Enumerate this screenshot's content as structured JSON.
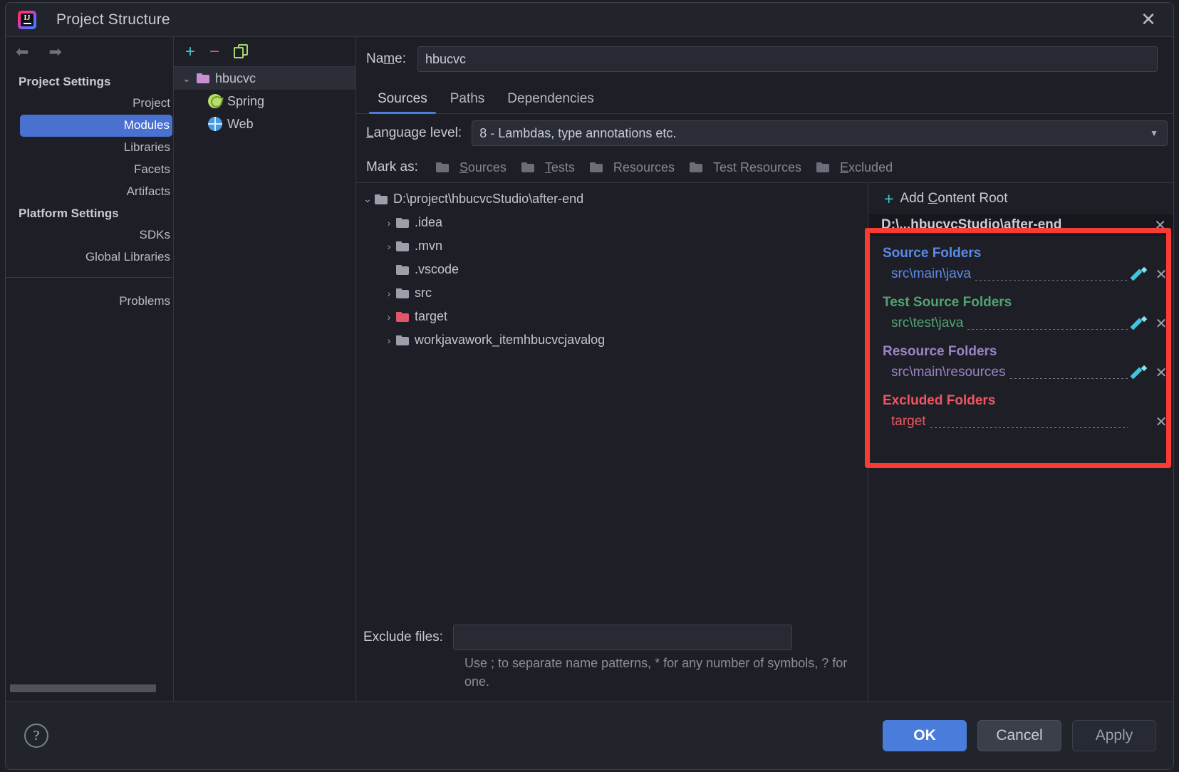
{
  "window": {
    "title": "Project Structure",
    "app_icon": "intellij-idea-icon",
    "close_label": "✕"
  },
  "nav": {
    "back_icon": "⬅",
    "forward_icon": "➡",
    "groups": [
      {
        "label": "Project Settings",
        "items": [
          "Project",
          "Modules",
          "Libraries",
          "Facets",
          "Artifacts"
        ]
      },
      {
        "label": "Platform Settings",
        "items": [
          "SDKs",
          "Global Libraries"
        ]
      }
    ],
    "selected": "Modules",
    "problems": "Problems"
  },
  "module_tree": {
    "toolbar": {
      "add": "+",
      "remove": "−",
      "copy": "copy-icon"
    },
    "nodes": [
      {
        "label": "hbucvc",
        "icon": "module-folder-icon",
        "expanded": true,
        "selected": true
      },
      {
        "label": "Spring",
        "icon": "spring-icon"
      },
      {
        "label": "Web",
        "icon": "web-icon"
      }
    ]
  },
  "main": {
    "name_label": "Name:",
    "name_value": "hbucvc",
    "name_placeholder": "",
    "tabs": [
      {
        "label": "Sources",
        "active": true
      },
      {
        "label": "Paths",
        "active": false
      },
      {
        "label": "Dependencies",
        "active": false
      }
    ],
    "language_level_label": "Language level:",
    "language_level_value": "8 - Lambdas, type annotations etc.",
    "mark_as_label": "Mark as:",
    "mark_as_options": [
      "Sources",
      "Tests",
      "Resources",
      "Test Resources",
      "Excluded"
    ],
    "file_tree": [
      {
        "label": "D:\\project\\hbucvcStudio\\after-end",
        "level": 0,
        "chevron": "∨",
        "color": "#9aa0ab"
      },
      {
        "label": ".idea",
        "level": 1,
        "chevron": "›",
        "color": "#9aa0ab"
      },
      {
        "label": ".mvn",
        "level": 1,
        "chevron": "›",
        "color": "#9aa0ab"
      },
      {
        "label": ".vscode",
        "level": 1,
        "chevron": "",
        "color": "#9aa0ab"
      },
      {
        "label": "src",
        "level": 1,
        "chevron": "›",
        "color": "#9aa0ab"
      },
      {
        "label": "target",
        "level": 1,
        "chevron": "›",
        "color": "#e0576c"
      },
      {
        "label": "workjavawork_itemhbucvcjavalog",
        "level": 1,
        "chevron": "›",
        "color": "#9aa0ab"
      }
    ],
    "exclude_files_label": "Exclude files:",
    "exclude_files_value": "",
    "exclude_hint": "Use ; to separate name patterns, * for any number of symbols, ? for one."
  },
  "content_roots": {
    "add_label": "Add Content Root",
    "add_icon": "plus-icon",
    "root_path": "D:\\...hbucvcStudio\\after-end",
    "root_close": "✕",
    "groups": [
      {
        "title": "Source Folders",
        "color": "#5b8ae8",
        "entries": [
          {
            "path": "src\\main\\java",
            "edit_icon": "pencil-icon",
            "remove_icon": "✕"
          }
        ]
      },
      {
        "title": "Test Source Folders",
        "color": "#52a373",
        "entries": [
          {
            "path": "src\\test\\java",
            "edit_icon": "pencil-icon",
            "remove_icon": "✕"
          }
        ]
      },
      {
        "title": "Resource Folders",
        "color": "#9a84c4",
        "entries": [
          {
            "path": "src\\main\\resources",
            "edit_icon": "pencil-icon",
            "remove_icon": "✕"
          }
        ]
      },
      {
        "title": "Excluded Folders",
        "color": "#f1555e",
        "entries": [
          {
            "path": "target",
            "edit_icon": "",
            "remove_icon": "✕"
          }
        ]
      }
    ],
    "highlight_color": "#fc3a34"
  },
  "footer": {
    "help_icon": "?",
    "ok": "OK",
    "cancel": "Cancel",
    "apply": "Apply"
  }
}
